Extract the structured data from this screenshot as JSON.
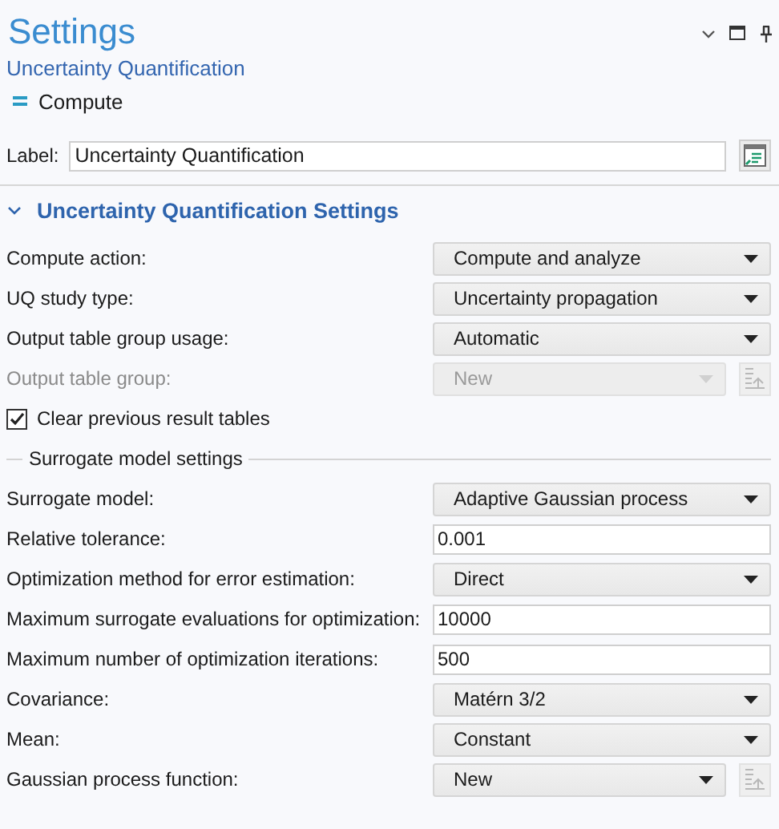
{
  "window": {
    "title": "Settings",
    "subtitle": "Uncertainty Quantification"
  },
  "toolbar": [
    {
      "label": "Compute"
    }
  ],
  "label_field": {
    "label": "Label:",
    "value": "Uncertainty Quantification"
  },
  "section": {
    "title": "Uncertainty Quantification Settings",
    "expanded": true
  },
  "rows": [
    {
      "kind": "select",
      "label": "Compute action:",
      "value": "Compute and analyze",
      "disabled": false
    },
    {
      "kind": "select",
      "label": "UQ study type:",
      "value": "Uncertainty propagation",
      "disabled": false
    },
    {
      "kind": "select",
      "label": "Output table group usage:",
      "value": "Automatic",
      "disabled": false
    },
    {
      "kind": "select_button",
      "label": "Output table group:",
      "value": "New",
      "disabled": true
    },
    {
      "kind": "checkbox",
      "label": "Clear previous result tables",
      "checked": true
    },
    {
      "kind": "subheading",
      "label": "Surrogate model settings"
    },
    {
      "kind": "select",
      "label": "Surrogate model:",
      "value": "Adaptive Gaussian process",
      "disabled": false
    },
    {
      "kind": "input",
      "label": "Relative tolerance:",
      "value": "0.001",
      "disabled": false
    },
    {
      "kind": "select",
      "label": "Optimization method for error estimation:",
      "value": "Direct",
      "disabled": false
    },
    {
      "kind": "input",
      "label": "Maximum surrogate evaluations for optimization:",
      "value": "10000",
      "disabled": false
    },
    {
      "kind": "input",
      "label": "Maximum number of optimization iterations:",
      "value": "500",
      "disabled": false
    },
    {
      "kind": "select",
      "label": "Covariance:",
      "value": "Matérn 3/2",
      "disabled": false
    },
    {
      "kind": "select",
      "label": "Mean:",
      "value": "Constant",
      "disabled": false
    },
    {
      "kind": "select_button",
      "label": "Gaussian process function:",
      "value": "New",
      "disabled": false
    }
  ]
}
